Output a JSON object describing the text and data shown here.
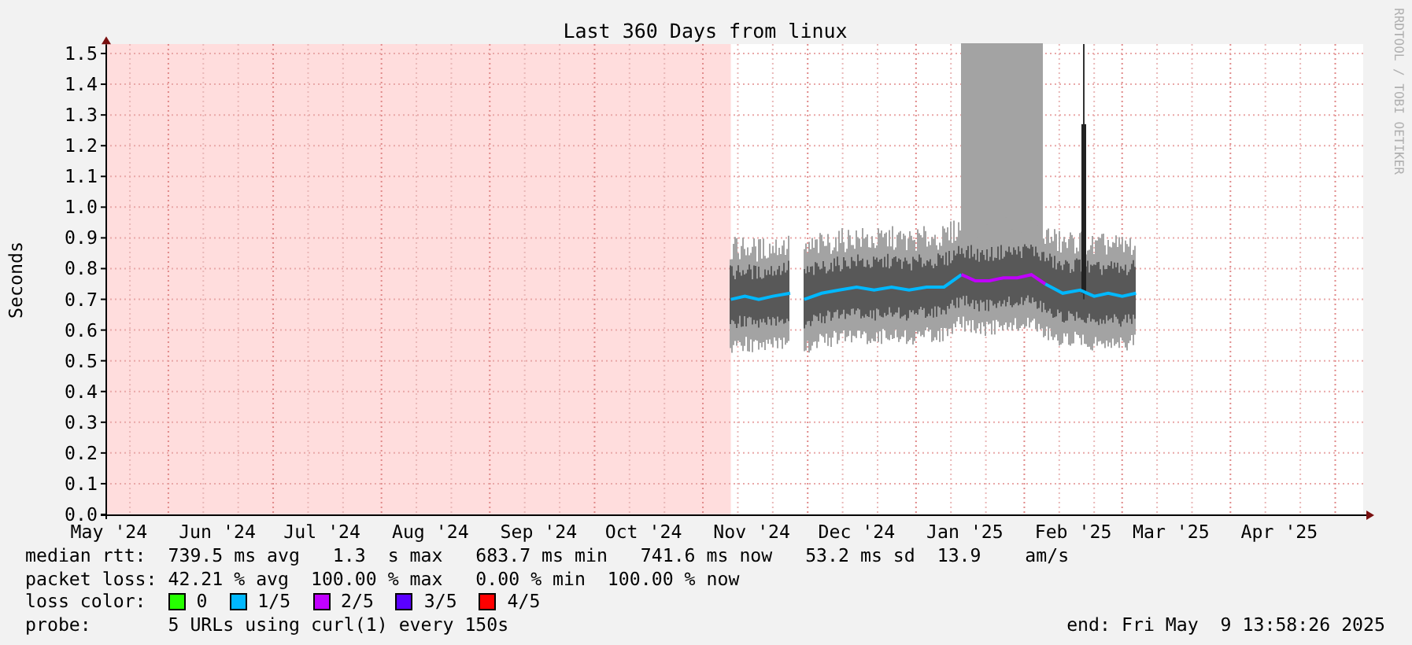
{
  "graph": {
    "title": "Last 360 Days from linux",
    "credit": "RRDTOOL / TOBI OETIKER",
    "chart_data": {
      "type": "line",
      "ylabel": "Seconds",
      "xlim": [
        "2024-05-14",
        "2025-05-09"
      ],
      "ylim": [
        0,
        1.53
      ],
      "grid": true,
      "x": [
        "2024-11-09",
        "2024-11-13",
        "2024-11-17",
        "2024-11-21",
        "2024-11-26",
        "2024-11-28",
        "2024-11-30",
        "2024-12-05",
        "2024-12-10",
        "2024-12-15",
        "2024-12-20",
        "2024-12-25",
        "2024-12-30",
        "2025-01-04",
        "2025-01-09",
        "2025-01-14",
        "2025-01-18",
        "2025-01-22",
        "2025-01-26",
        "2025-01-30",
        "2025-02-03",
        "2025-02-07",
        "2025-02-12",
        "2025-02-17",
        "2025-02-21",
        "2025-02-25",
        "2025-03-01",
        "2025-03-05"
      ],
      "series": [
        {
          "color": "#00b8ff",
          "values": [
            0.7,
            0.71,
            0.7,
            0.71,
            0.72,
            null,
            0.7,
            0.72,
            0.73,
            0.74,
            0.73,
            0.74,
            0.73,
            0.74,
            0.74,
            0.78,
            null,
            null,
            null,
            null,
            null,
            0.75,
            0.72,
            0.73,
            0.71,
            0.72,
            0.71,
            0.72
          ]
        },
        {
          "color": "#c000ff",
          "values": [
            null,
            null,
            null,
            null,
            null,
            null,
            null,
            null,
            null,
            null,
            null,
            null,
            null,
            null,
            null,
            0.78,
            0.76,
            0.76,
            0.77,
            0.77,
            0.78,
            0.75,
            null,
            null,
            null,
            null,
            null,
            null
          ]
        }
      ],
      "xticks": [
        {
          "value": "2024-05-15",
          "label": "May '24"
        },
        {
          "value": "2024-06-15",
          "label": "Jun '24"
        },
        {
          "value": "2024-07-15",
          "label": "Jul '24"
        },
        {
          "value": "2024-08-15",
          "label": "Aug '24"
        },
        {
          "value": "2024-09-15",
          "label": "Sep '24"
        },
        {
          "value": "2024-10-15",
          "label": "Oct '24"
        },
        {
          "value": "2024-11-15",
          "label": "Nov '24"
        },
        {
          "value": "2024-12-15",
          "label": "Dec '24"
        },
        {
          "value": "2025-01-15",
          "label": "Jan '25"
        },
        {
          "value": "2025-02-15",
          "label": "Feb '25"
        },
        {
          "value": "2025-03-15",
          "label": "Mar '25"
        },
        {
          "value": "2025-04-15",
          "label": "Apr '25"
        }
      ],
      "yticks": [
        {
          "value": 0,
          "label": "0.0"
        },
        {
          "value": 0.1,
          "label": "0.1"
        },
        {
          "value": 0.2,
          "label": "0.2"
        },
        {
          "value": 0.3,
          "label": "0.3"
        },
        {
          "value": 0.4,
          "label": "0.4"
        },
        {
          "value": 0.5,
          "label": "0.5"
        },
        {
          "value": 0.6,
          "label": "0.6"
        },
        {
          "value": 0.7,
          "label": "0.7"
        },
        {
          "value": 0.8,
          "label": "0.8"
        },
        {
          "value": 0.9,
          "label": "0.9"
        },
        {
          "value": 1.0,
          "label": "1.0"
        },
        {
          "value": 1.1,
          "label": "1.1"
        },
        {
          "value": 1.2,
          "label": "1.2"
        },
        {
          "value": 1.3,
          "label": "1.3"
        },
        {
          "value": 1.4,
          "label": "1.4"
        },
        {
          "value": 1.5,
          "label": "1.5"
        }
      ]
    }
  },
  "legend": [
    {
      "kind": "stats",
      "label": "median rtt:",
      "text": "739.5 ms avg   1.3  s max   683.7 ms min   741.6 ms now   53.2 ms sd  13.9    am/s"
    },
    {
      "kind": "stats",
      "label": "packet loss:",
      "text": "42.21 % avg  100.00 % max   0.00 % min  100.00 % now"
    },
    {
      "kind": "colors",
      "label": "loss color:",
      "items": [
        {
          "label": "0",
          "color": "#26ff00"
        },
        {
          "label": "1/5",
          "color": "#00b8ff"
        },
        {
          "label": "2/5",
          "color": "#c000ff"
        },
        {
          "label": "3/5",
          "color": "#5a00ff"
        },
        {
          "label": "4/5",
          "color": "#ff0000"
        }
      ]
    },
    {
      "kind": "stats",
      "label": "probe:",
      "text": "5 URLs using curl(1) every 150s"
    }
  ],
  "end": "end: Fri May  9 13:58:26 2025"
}
